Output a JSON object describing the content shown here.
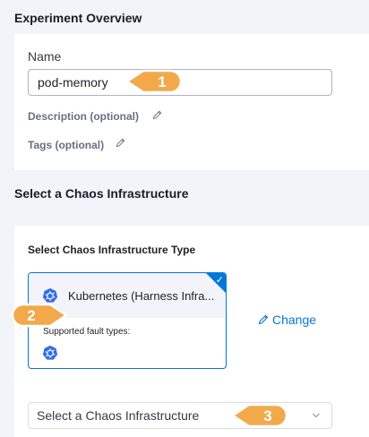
{
  "overview": {
    "title": "Experiment Overview",
    "name_label": "Name",
    "name_value": "pod-memory",
    "description_label": "Description (optional)",
    "tags_label": "Tags (optional)"
  },
  "infrastructure": {
    "title": "Select a Chaos Infrastructure",
    "type_title": "Select Chaos Infrastructure Type",
    "selected_type": {
      "label": "Kubernetes (Harness Infra...",
      "supported_label": "Supported fault types:",
      "icon": "kubernetes-icon",
      "selected": true
    },
    "change_label": "Change",
    "select_placeholder": "Select a Chaos Infrastructure"
  },
  "callouts": [
    "1",
    "2",
    "3"
  ],
  "colors": {
    "accent": "#0278d5",
    "callout": "#f2a94a",
    "kubernetes": "#326ce5"
  }
}
